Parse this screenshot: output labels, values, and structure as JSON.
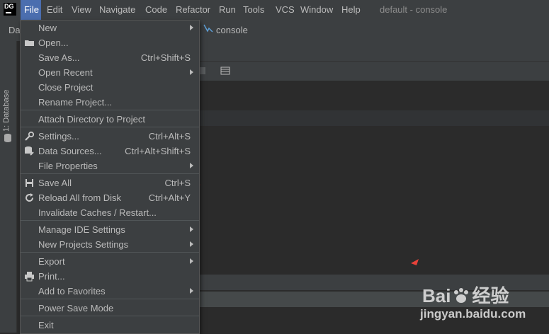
{
  "menubar": {
    "items": [
      "File",
      "Edit",
      "View",
      "Navigate",
      "Code",
      "Refactor",
      "Run",
      "Tools",
      "VCS",
      "Window",
      "Help"
    ],
    "window_title": "default - console",
    "logo_text": "DG"
  },
  "navbar": {
    "left_text": "Dat",
    "tab_label": "console"
  },
  "left_strip": {
    "label": "1: Database"
  },
  "file_menu": {
    "items": [
      {
        "label": "New",
        "shortcut": "",
        "submenu": true,
        "icon": ""
      },
      {
        "label": "Open...",
        "shortcut": "",
        "submenu": false,
        "icon": "folder-icon"
      },
      {
        "label": "Save As...",
        "shortcut": "Ctrl+Shift+S",
        "submenu": false,
        "icon": ""
      },
      {
        "label": "Open Recent",
        "shortcut": "",
        "submenu": true,
        "icon": ""
      },
      {
        "label": "Close Project",
        "shortcut": "",
        "submenu": false,
        "icon": ""
      },
      {
        "label": "Rename Project...",
        "shortcut": "",
        "submenu": false,
        "icon": ""
      },
      {
        "label": "Attach Directory to Project",
        "shortcut": "",
        "submenu": false,
        "icon": ""
      },
      {
        "label": "Settings...",
        "shortcut": "Ctrl+Alt+S",
        "submenu": false,
        "icon": "wrench-icon"
      },
      {
        "label": "Data Sources...",
        "shortcut": "Ctrl+Alt+Shift+S",
        "submenu": false,
        "icon": "data-sources-icon"
      },
      {
        "label": "File Properties",
        "shortcut": "",
        "submenu": true,
        "icon": ""
      },
      {
        "label": "Save All",
        "shortcut": "Ctrl+S",
        "submenu": false,
        "icon": "save-icon"
      },
      {
        "label": "Reload All from Disk",
        "shortcut": "Ctrl+Alt+Y",
        "submenu": false,
        "icon": "reload-icon"
      },
      {
        "label": "Invalidate Caches / Restart...",
        "shortcut": "",
        "submenu": false,
        "icon": ""
      },
      {
        "label": "Manage IDE Settings",
        "shortcut": "",
        "submenu": true,
        "icon": ""
      },
      {
        "label": "New Projects Settings",
        "shortcut": "",
        "submenu": true,
        "icon": ""
      },
      {
        "label": "Export",
        "shortcut": "",
        "submenu": true,
        "icon": ""
      },
      {
        "label": "Print...",
        "shortcut": "",
        "submenu": false,
        "icon": "print-icon"
      },
      {
        "label": "Add to Favorites",
        "shortcut": "",
        "submenu": true,
        "icon": ""
      },
      {
        "label": "Power Save Mode",
        "shortcut": "",
        "submenu": false,
        "icon": ""
      },
      {
        "label": "Exit",
        "shortcut": "",
        "submenu": false,
        "icon": ""
      }
    ]
  },
  "watermark": {
    "brand": "Bai",
    "brand2": "经验",
    "url": "jingyan.baidu.com"
  },
  "colors": {
    "menubar_bg": "#3c3f41",
    "active_menu": "#4b6eaf",
    "annotation": "#e8423a"
  }
}
